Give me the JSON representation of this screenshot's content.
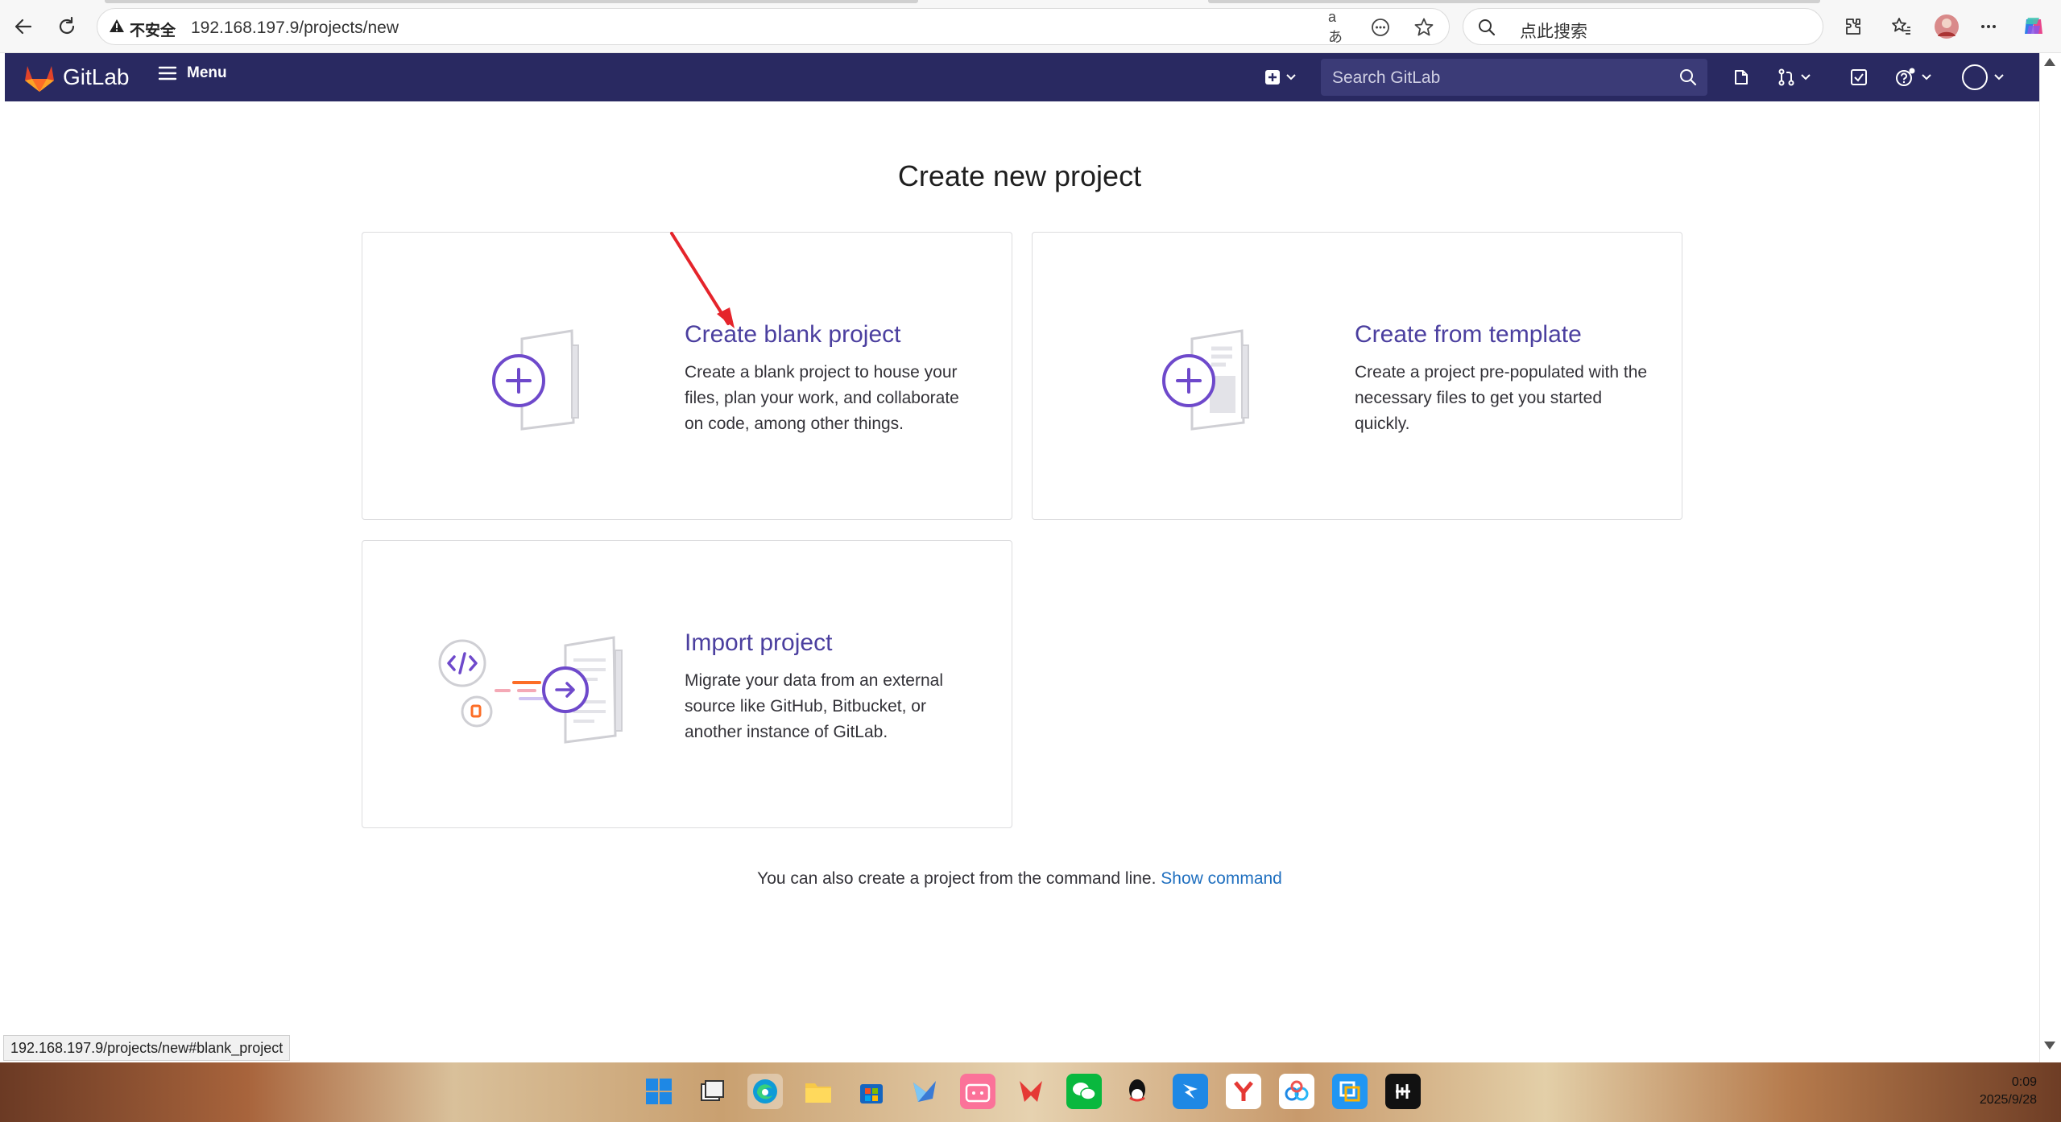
{
  "browser": {
    "insecure_label": "不安全",
    "url": "192.168.197.9/projects/new",
    "search_placeholder": "点此搜索",
    "read_aloud_glyph": "aあ"
  },
  "header": {
    "brand": "GitLab",
    "menu_label": "Menu",
    "search_placeholder": "Search GitLab"
  },
  "main": {
    "title": "Create new project",
    "cards": [
      {
        "title": "Create blank project",
        "description": "Create a blank project to house your files, plan your work, and collaborate on code, among other things."
      },
      {
        "title": "Create from template",
        "description": "Create a project pre-populated with the necessary files to get you started quickly."
      },
      {
        "title": "Import project",
        "description": "Migrate your data from an external source like GitHub, Bitbucket, or another instance of GitLab."
      }
    ],
    "cli_text": "You can also create a project from the command line.",
    "cli_link": "Show command"
  },
  "status_bar": {
    "hover_url": "192.168.197.9/projects/new#blank_project"
  },
  "taskbar": {
    "time": "0:09",
    "date": "2025/9/28"
  },
  "colors": {
    "header_bg": "#292961",
    "accent_purple": "#4b3f9f",
    "link_blue": "#1f6fbf",
    "annotation_red": "#e5242b"
  }
}
